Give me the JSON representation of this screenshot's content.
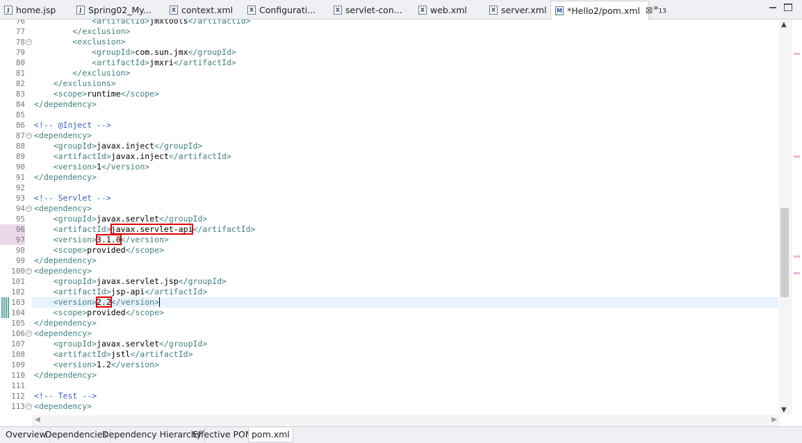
{
  "tabs": [
    {
      "label": "home.jsp",
      "icon": "jsp-file-icon",
      "icon_glyph": "J"
    },
    {
      "label": "Spring02_My...",
      "icon": "jsp-file-icon",
      "icon_glyph": "J"
    },
    {
      "label": "context.xml",
      "icon": "xml-file-icon",
      "icon_glyph": "X"
    },
    {
      "label": "Configurati...",
      "icon": "xml-file-icon",
      "icon_glyph": "X"
    },
    {
      "label": "servlet-con...",
      "icon": "xml-file-icon",
      "icon_glyph": "X"
    },
    {
      "label": "web.xml",
      "icon": "xml-file-icon",
      "icon_glyph": "X"
    },
    {
      "label": "server.xml",
      "icon": "xml-file-icon",
      "icon_glyph": "X"
    },
    {
      "label": "*Hello2/pom.xml",
      "icon": "maven-pom-icon",
      "icon_glyph": "M",
      "active": true
    }
  ],
  "tab_overflow": {
    "symbol": "»",
    "count": "13"
  },
  "close_glyph": "⊠",
  "editor": {
    "lines": [
      {
        "n": "76",
        "fold": false,
        "segs": [
          [
            "tg",
            "            <artifactId>"
          ],
          [
            "tx",
            "jmxtools"
          ],
          [
            "tg",
            "</artifactId>"
          ]
        ]
      },
      {
        "n": "77",
        "fold": false,
        "segs": [
          [
            "tg",
            "        </exclusion>"
          ]
        ]
      },
      {
        "n": "78",
        "fold": true,
        "segs": [
          [
            "tg",
            "        <exclusion>"
          ]
        ]
      },
      {
        "n": "79",
        "fold": false,
        "segs": [
          [
            "tg",
            "            <groupId>"
          ],
          [
            "tx",
            "com.sun.jmx"
          ],
          [
            "tg",
            "</groupId>"
          ]
        ]
      },
      {
        "n": "80",
        "fold": false,
        "segs": [
          [
            "tg",
            "            <artifactId>"
          ],
          [
            "tx",
            "jmxri"
          ],
          [
            "tg",
            "</artifactId>"
          ]
        ]
      },
      {
        "n": "81",
        "fold": false,
        "segs": [
          [
            "tg",
            "        </exclusion>"
          ]
        ]
      },
      {
        "n": "82",
        "fold": false,
        "segs": [
          [
            "tg",
            "    </exclusions>"
          ]
        ]
      },
      {
        "n": "83",
        "fold": false,
        "segs": [
          [
            "tg",
            "    <scope>"
          ],
          [
            "tx",
            "runtime"
          ],
          [
            "tg",
            "</scope>"
          ]
        ]
      },
      {
        "n": "84",
        "fold": false,
        "segs": [
          [
            "tg",
            "</dependency>"
          ]
        ]
      },
      {
        "n": "85",
        "fold": false,
        "segs": []
      },
      {
        "n": "86",
        "fold": false,
        "segs": [
          [
            "cm",
            "<!-- @Inject -->"
          ]
        ]
      },
      {
        "n": "87",
        "fold": true,
        "segs": [
          [
            "tg",
            "<dependency>"
          ]
        ]
      },
      {
        "n": "88",
        "fold": false,
        "segs": [
          [
            "tg",
            "    <groupId>"
          ],
          [
            "tx",
            "javax.inject"
          ],
          [
            "tg",
            "</groupId>"
          ]
        ]
      },
      {
        "n": "89",
        "fold": false,
        "segs": [
          [
            "tg",
            "    <artifactId>"
          ],
          [
            "tx",
            "javax.inject"
          ],
          [
            "tg",
            "</artifactId>"
          ]
        ]
      },
      {
        "n": "90",
        "fold": false,
        "segs": [
          [
            "tg",
            "    <version>"
          ],
          [
            "tx",
            "1"
          ],
          [
            "tg",
            "</version>"
          ]
        ]
      },
      {
        "n": "91",
        "fold": false,
        "segs": [
          [
            "tg",
            "</dependency>"
          ]
        ]
      },
      {
        "n": "92",
        "fold": false,
        "segs": []
      },
      {
        "n": "93",
        "fold": false,
        "segs": [
          [
            "cm",
            "<!-- Servlet -->"
          ]
        ]
      },
      {
        "n": "94",
        "fold": true,
        "segs": [
          [
            "tg",
            "<dependency>"
          ]
        ]
      },
      {
        "n": "95",
        "fold": false,
        "segs": [
          [
            "tg",
            "    <groupId>"
          ],
          [
            "tx",
            "javax.servlet"
          ],
          [
            "tg",
            "</groupId>"
          ]
        ]
      },
      {
        "n": "96",
        "fold": false,
        "mark": true,
        "segs": [
          [
            "tg",
            "    <artifactId>"
          ],
          [
            "tx hl",
            "javax.servlet-api"
          ],
          [
            "tg",
            "</artifactId>"
          ]
        ]
      },
      {
        "n": "97",
        "fold": false,
        "mark": true,
        "segs": [
          [
            "tg",
            "    <version>"
          ],
          [
            "tx hl",
            "3.1.0"
          ],
          [
            "tg",
            "</version>"
          ]
        ]
      },
      {
        "n": "98",
        "fold": false,
        "segs": [
          [
            "tg",
            "    <scope>"
          ],
          [
            "tx",
            "provided"
          ],
          [
            "tg",
            "</scope>"
          ]
        ]
      },
      {
        "n": "99",
        "fold": false,
        "segs": [
          [
            "tg",
            "</dependency>"
          ]
        ]
      },
      {
        "n": "100",
        "fold": true,
        "segs": [
          [
            "tg",
            "<dependency>"
          ]
        ]
      },
      {
        "n": "101",
        "fold": false,
        "segs": [
          [
            "tg",
            "    <groupId>"
          ],
          [
            "tx",
            "javax.servlet.jsp"
          ],
          [
            "tg",
            "</groupId>"
          ]
        ]
      },
      {
        "n": "102",
        "fold": false,
        "segs": [
          [
            "tg",
            "    <artifactId>"
          ],
          [
            "tx",
            "jsp-api"
          ],
          [
            "tg",
            "</artifactId>"
          ]
        ]
      },
      {
        "n": "103",
        "fold": false,
        "current": true,
        "segs": [
          [
            "tg",
            "    <version>"
          ],
          [
            "tx hl",
            "2.2"
          ],
          [
            "tg caret",
            "</version>"
          ]
        ]
      },
      {
        "n": "104",
        "fold": false,
        "segs": [
          [
            "tg",
            "    <scope>"
          ],
          [
            "tx",
            "provided"
          ],
          [
            "tg",
            "</scope>"
          ]
        ]
      },
      {
        "n": "105",
        "fold": false,
        "segs": [
          [
            "tg",
            "</dependency>"
          ]
        ]
      },
      {
        "n": "106",
        "fold": true,
        "segs": [
          [
            "tg",
            "<dependency>"
          ]
        ]
      },
      {
        "n": "107",
        "fold": false,
        "segs": [
          [
            "tg",
            "    <groupId>"
          ],
          [
            "tx",
            "javax.servlet"
          ],
          [
            "tg",
            "</groupId>"
          ]
        ]
      },
      {
        "n": "108",
        "fold": false,
        "segs": [
          [
            "tg",
            "    <artifactId>"
          ],
          [
            "tx",
            "jstl"
          ],
          [
            "tg",
            "</artifactId>"
          ]
        ]
      },
      {
        "n": "109",
        "fold": false,
        "segs": [
          [
            "tg",
            "    <version>"
          ],
          [
            "tx",
            "1.2"
          ],
          [
            "tg",
            "</version>"
          ]
        ]
      },
      {
        "n": "110",
        "fold": false,
        "segs": [
          [
            "tg",
            "</dependency>"
          ]
        ]
      },
      {
        "n": "111",
        "fold": false,
        "segs": []
      },
      {
        "n": "112",
        "fold": false,
        "segs": [
          [
            "cm",
            "<!-- Test -->"
          ]
        ]
      },
      {
        "n": "113",
        "fold": true,
        "segs": [
          [
            "tg",
            "<dependency>"
          ]
        ]
      }
    ]
  },
  "bottom_tabs": [
    {
      "label": "Overview"
    },
    {
      "label": "Dependencies"
    },
    {
      "label": "Dependency Hierarchy"
    },
    {
      "label": "Effective POM"
    },
    {
      "label": "pom.xml",
      "active": true
    }
  ],
  "colors": {
    "tag": "#3f7f7f",
    "text": "#000000",
    "comment": "#3f5fbf",
    "highlight_box": "#e00000",
    "current_line": "#e8f2fe"
  }
}
